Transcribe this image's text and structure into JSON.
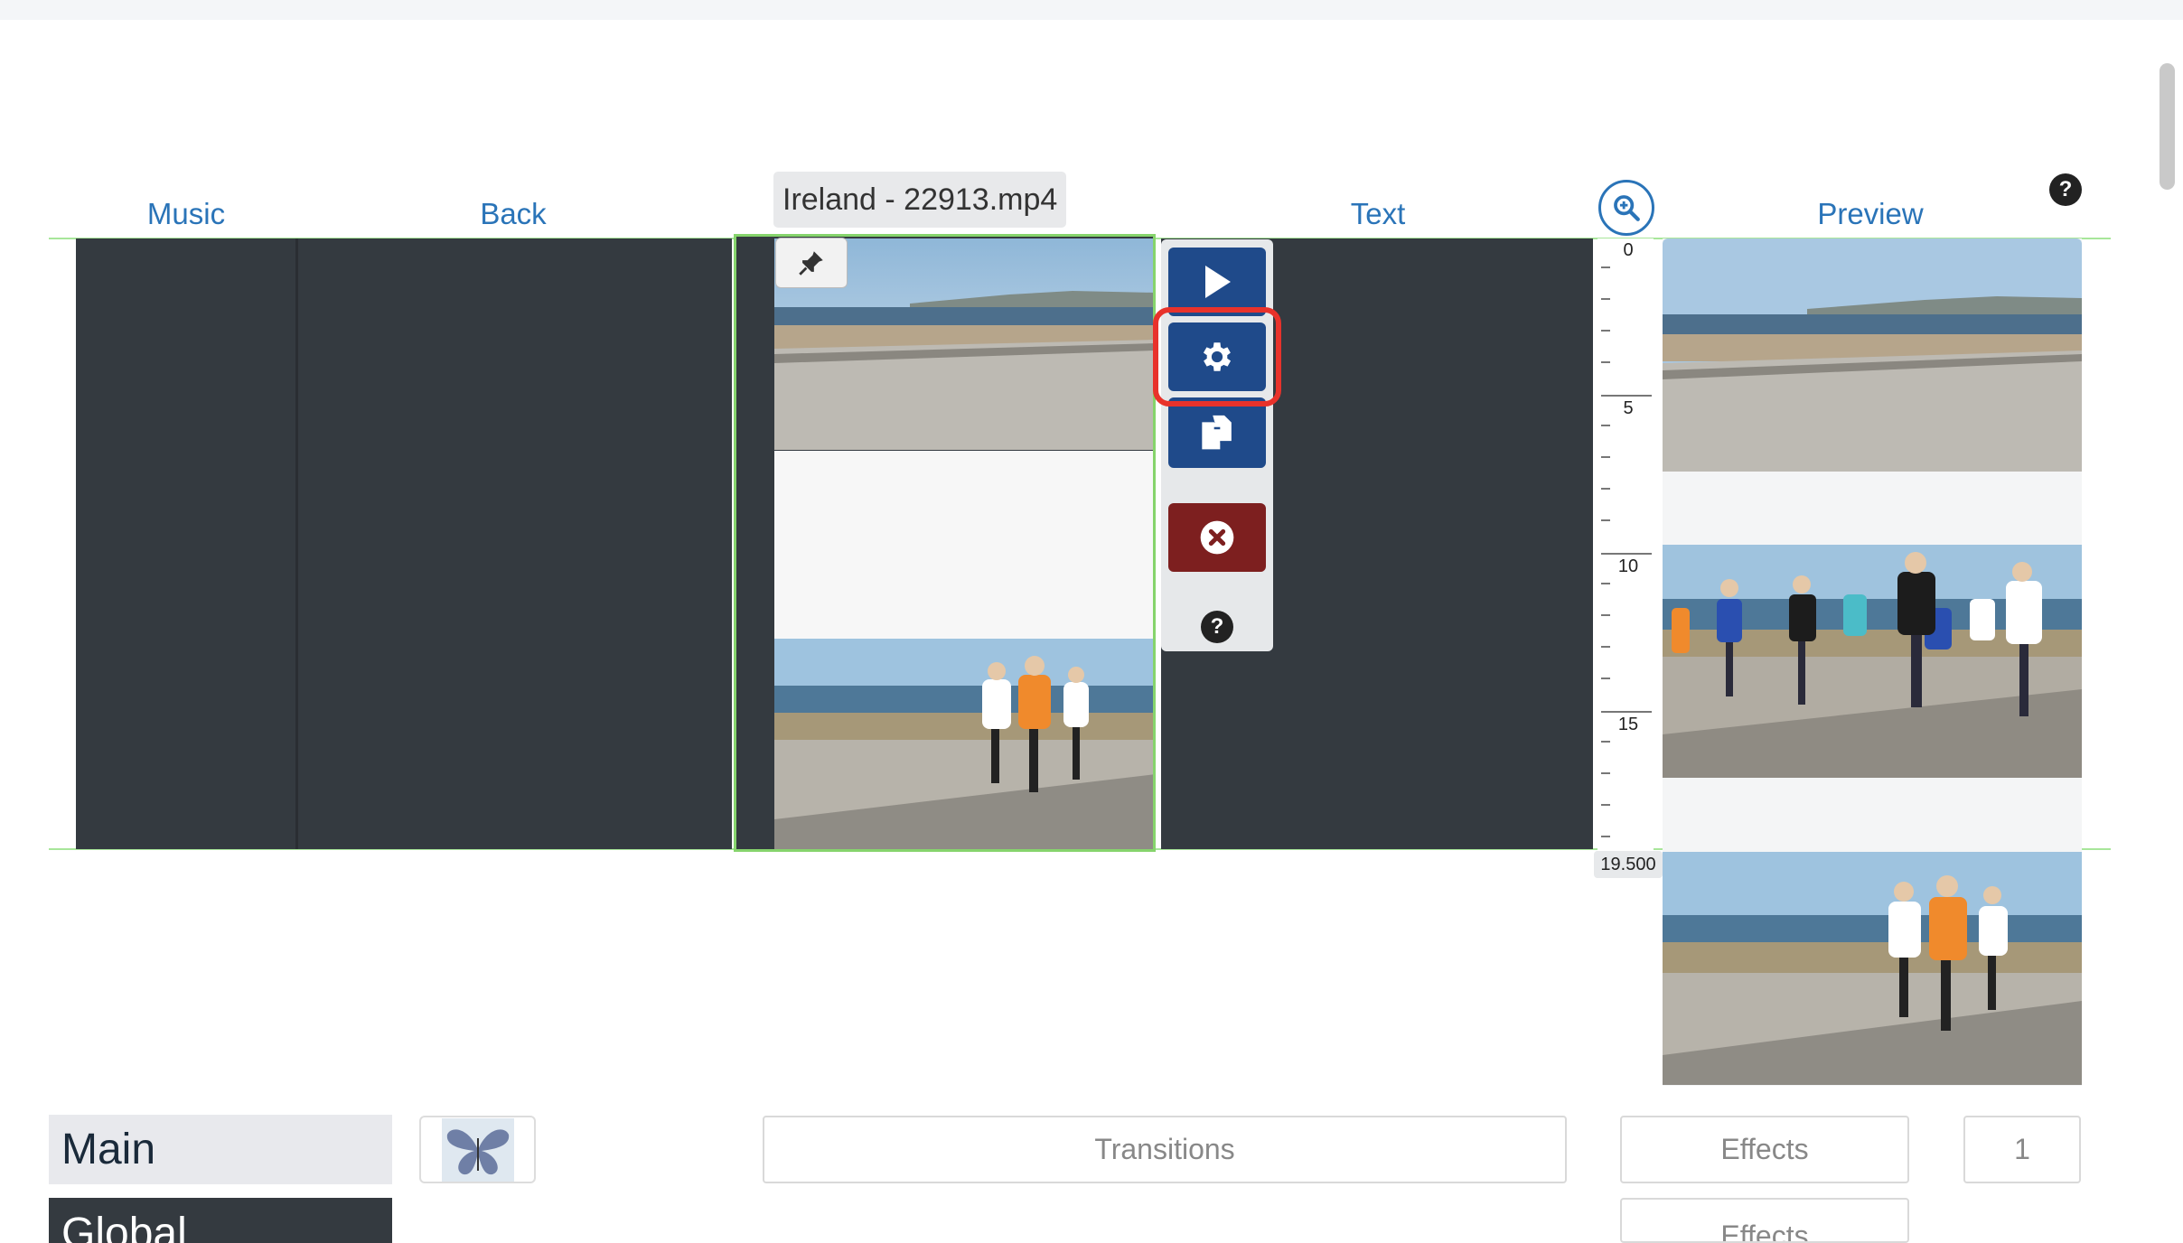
{
  "columns": {
    "music": "Music",
    "back": "Back",
    "text": "Text",
    "preview": "Preview"
  },
  "track": {
    "title": "Ireland - 22913.mp4"
  },
  "controls": {
    "play_icon": "play-icon",
    "settings_icon": "gear-icon",
    "copy_icon": "copy-icon",
    "delete_icon": "close-circle-icon",
    "help_icon": "question-icon",
    "help_label": "?"
  },
  "header": {
    "help_label": "?",
    "zoom_icon": "zoom-in-icon"
  },
  "ruler": {
    "labels": [
      "0",
      "5",
      "10",
      "15"
    ],
    "end_value": "19.500"
  },
  "bottom": {
    "main_label": "Main",
    "global_label": "Global",
    "transitions_label": "Transitions",
    "effects_label": "Effects",
    "effects2_label": "Effects",
    "count_value": "1"
  },
  "colors": {
    "accent_blue": "#2a74b8",
    "button_blue": "#1f4a8a",
    "delete_red": "#7d1f1f",
    "highlight_red": "#e8322b",
    "panel_dark": "#343a40",
    "selection_green": "#86d46c"
  }
}
